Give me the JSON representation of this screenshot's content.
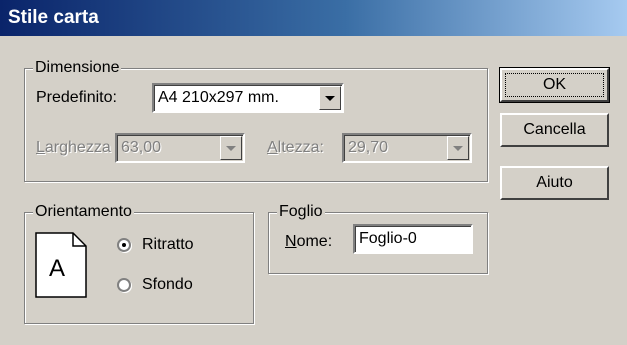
{
  "window": {
    "title": "Stile carta"
  },
  "dimensione": {
    "legend": "Dimensione",
    "predefinito_label": "Predefinito:",
    "predefinito_value": "A4 210x297 mm.",
    "larghezza_label_u": "L",
    "larghezza_label_rest": "arghezza",
    "larghezza_value": "63,00",
    "altezza_label_u": "A",
    "altezza_label_rest": "ltezza:",
    "altezza_value": "29,70"
  },
  "orientamento": {
    "legend": "Orientamento",
    "page_icon_letter": "A",
    "options": [
      {
        "label": "Ritratto",
        "selected": true
      },
      {
        "label": "Sfondo",
        "selected": false
      }
    ]
  },
  "foglio": {
    "legend": "Foglio",
    "nome_label_u": "N",
    "nome_label_rest": "ome:",
    "nome_value": "Foglio-0"
  },
  "buttons": {
    "ok": "OK",
    "cancel": "Cancella",
    "help": "Aiuto"
  }
}
